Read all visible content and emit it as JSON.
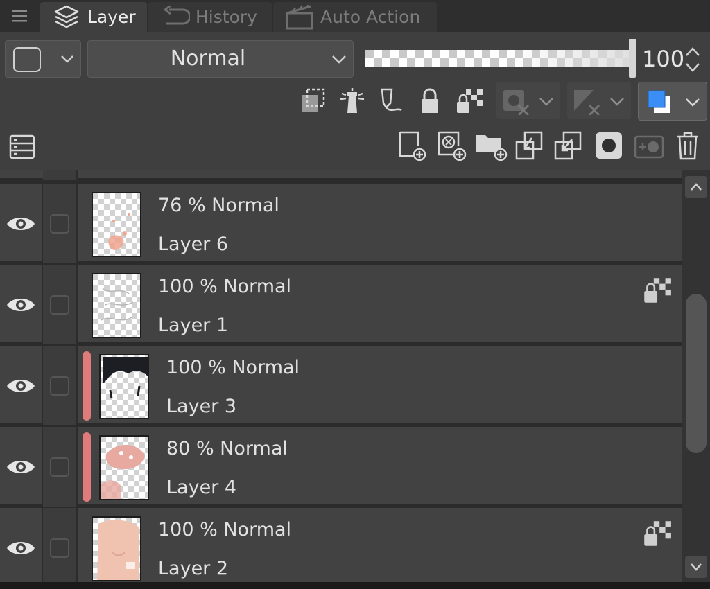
{
  "tabs": [
    {
      "label": "Layer",
      "icon": "layers-icon",
      "active": true
    },
    {
      "label": "History",
      "icon": "history-icon",
      "active": false
    },
    {
      "label": "Auto Action",
      "icon": "clapperboard-icon",
      "active": false
    }
  ],
  "properties": {
    "blend_mode": "Normal",
    "opacity": "100",
    "opacity_fraction": 1.0,
    "toolbar_icons": [
      "clip-to-layer-below-icon",
      "reference-layer-icon",
      "draft-layer-icon",
      "lock-layer-icon",
      "lock-transparent-pixels-icon",
      "mask-disabled-icon",
      "ruler-disabled-icon",
      "layer-color-icon"
    ],
    "action_icons": [
      "new-raster-layer-icon",
      "new-vector-layer-icon",
      "new-layer-folder-icon",
      "transfer-to-lower-layer-icon",
      "combine-with-layer-below-icon",
      "create-layer-mask-icon",
      "apply-mask-icon",
      "delete-layer-icon"
    ]
  },
  "layers": [
    {
      "opacity_mode": "76 % Normal",
      "name": "Layer 6",
      "clipped": false,
      "lock_transparent": false
    },
    {
      "opacity_mode": "100 % Normal",
      "name": "Layer 1",
      "clipped": false,
      "lock_transparent": true
    },
    {
      "opacity_mode": "100 % Normal",
      "name": "Layer 3",
      "clipped": true,
      "lock_transparent": false
    },
    {
      "opacity_mode": "80 % Normal",
      "name": "Layer 4",
      "clipped": true,
      "lock_transparent": false
    },
    {
      "opacity_mode": "100 % Normal",
      "name": "Layer 2",
      "clipped": false,
      "lock_transparent": true
    }
  ],
  "colors": {
    "panel_bg": "#3f3f3f",
    "row_bg": "#424242",
    "clip_indicator": "#e07b7b",
    "main_color": "#3a8ef6",
    "sub_color": "#ffffff"
  }
}
